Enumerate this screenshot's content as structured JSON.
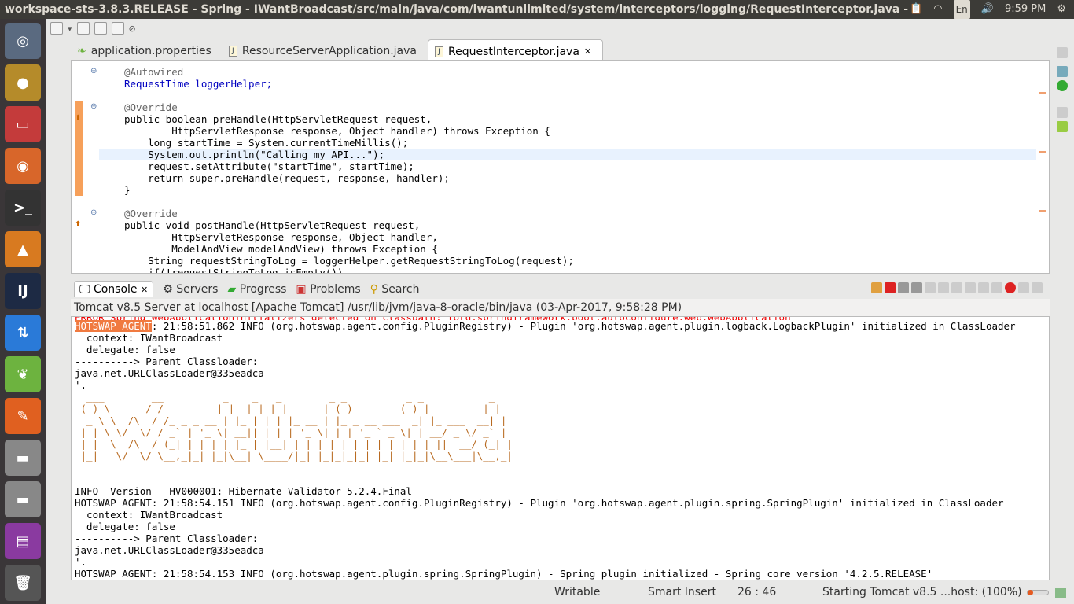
{
  "window": {
    "title": "workspace-sts-3.8.3.RELEASE - Spring - IWantBroadcast/src/main/java/com/iwantunlimited/system/interceptors/logging/RequestInterceptor.java - Spring Tool Suite"
  },
  "tray": {
    "keyboard": "En",
    "clock": "9:59 PM"
  },
  "editor_tabs": [
    {
      "label": "application.properties"
    },
    {
      "label": "ResourceServerApplication.java"
    },
    {
      "label": "RequestInterceptor.java",
      "close": "✕"
    }
  ],
  "code": [
    "@Autowired",
    "RequestTime loggerHelper;",
    "",
    "@Override",
    "public boolean preHandle(HttpServletRequest request,",
    "        HttpServletResponse response, Object handler) throws Exception {",
    "    long startTime = System.currentTimeMillis();",
    "    System.out.println(\"Calling my API...\");",
    "    request.setAttribute(\"startTime\", startTime);",
    "    return super.preHandle(request, response, handler);",
    "}",
    "",
    "@Override",
    "public void postHandle(HttpServletRequest request,",
    "        HttpServletResponse response, Object handler,",
    "        ModelAndView modelAndView) throws Exception {",
    "    String requestStringToLog = loggerHelper.getRequestStringToLog(request);",
    "    if(!requestStringToLog.isEmpty())"
  ],
  "console_tabs": [
    {
      "label": "Console",
      "close": "✕"
    },
    {
      "label": "Servers"
    },
    {
      "label": "Progress"
    },
    {
      "label": "Problems"
    },
    {
      "label": "Search"
    }
  ],
  "console_header": "Tomcat v8.5 Server at localhost [Apache Tomcat] /usr/lib/jvm/java-8-oracle/bin/java (03-Apr-2017, 9:58:28 PM)",
  "console": {
    "partial_red": "ERROR Spring WebApplicationInitializers detected on classpath: [org.springframework.boot.autoconfigure.web.WebApplication",
    "hotswap_tag": "HOTSWAP AGENT",
    "line1_rest": ": 21:58:51.862 INFO (org.hotswap.agent.config.PluginRegistry) - Plugin 'org.hotswap.agent.plugin.logback.LogbackPlugin' initialized in ClassLoader",
    "lines_a": [
      "  context: IWantBroadcast",
      "  delegate: false",
      "----------> Parent Classloader:",
      "java.net.URLClassLoader@335eadca",
      "'."
    ],
    "art": [
      "  ___        __          _    _   _        _ _          _ _           _ ",
      " (_) \\      / /         | |  | | | |      | (_)        (_) |         | |",
      "  _ \\ \\  /\\  / /_ _ _ __ | |_ | | | |_ __ | |_ _ __ ___  _| |_ ___  __| |",
      " | | \\ \\/  \\/ / _` | '_ \\| __|| | | | '_ \\| | | '_ ` _ \\| | __/ _ \\/ _` |",
      " | |  \\  /\\  / (_| | | | | |_ | |__| | | | | | | | | | | | | ||  __/ (_| |",
      " |_|   \\/  \\/ \\__,_|_| |_|\\__| \\____/|_| |_|_|_|_| |_| |_|_|\\__\\___|\\__,_|"
    ],
    "lines_b": [
      "INFO  Version - HV000001: Hibernate Validator 5.2.4.Final",
      "HOTSWAP AGENT: 21:58:54.151 INFO (org.hotswap.agent.config.PluginRegistry) - Plugin 'org.hotswap.agent.plugin.spring.SpringPlugin' initialized in ClassLoader",
      "  context: IWantBroadcast",
      "  delegate: false",
      "----------> Parent Classloader:",
      "java.net.URLClassLoader@335eadca",
      "'.",
      "HOTSWAP AGENT: 21:58:54.153 INFO (org.hotswap.agent.plugin.spring.SpringPlugin) - Spring plugin initialized - Spring core version '4.2.5.RELEASE'"
    ]
  },
  "status": {
    "mode": "Writable",
    "insert": "Smart Insert",
    "position": "26 : 46",
    "progress": "Starting Tomcat v8.5 ...host: (100%)"
  }
}
